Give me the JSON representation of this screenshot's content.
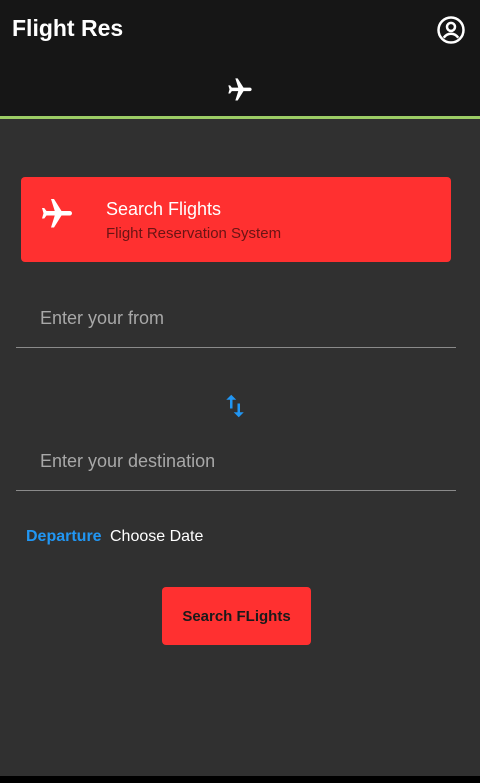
{
  "app_bar": {
    "title": "Flight Res",
    "account_icon": "account-circle-icon",
    "tab_icon": "airplane-icon",
    "indicator_color": "#9ccc65"
  },
  "banner": {
    "icon": "airplane-icon",
    "title": "Search Flights",
    "subtitle": "Flight Reservation System",
    "color": "#ff3030"
  },
  "form": {
    "from_placeholder": "Enter your from",
    "from_value": "",
    "swap_icon": "swap-vertical-icon",
    "destination_placeholder": "Enter your destination",
    "destination_value": "",
    "departure_label": "Departure",
    "date_text": "Choose Date"
  },
  "actions": {
    "search_label": "Search FLights"
  },
  "colors": {
    "background": "#303030",
    "app_bar": "#161616",
    "accent_blue": "#2196f3",
    "accent_red": "#ff3030"
  }
}
